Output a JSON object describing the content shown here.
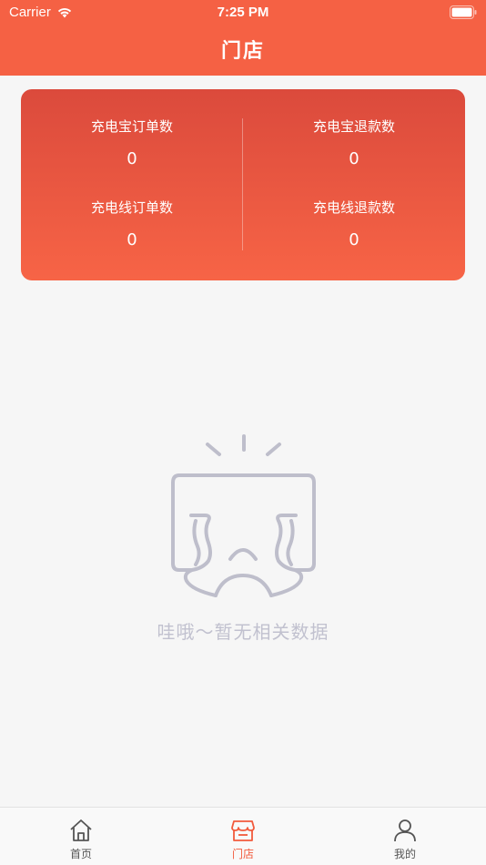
{
  "status_bar": {
    "carrier": "Carrier",
    "time": "7:25 PM"
  },
  "nav": {
    "title": "门店"
  },
  "stats": [
    {
      "label": "充电宝订单数",
      "value": "0"
    },
    {
      "label": "充电宝退款数",
      "value": "0"
    },
    {
      "label": "充电线订单数",
      "value": "0"
    },
    {
      "label": "充电线退款数",
      "value": "0"
    }
  ],
  "empty_state": {
    "message": "哇哦～暂无相关数据",
    "icon": "crying-box-icon"
  },
  "tabs": [
    {
      "label": "首页",
      "icon": "home-icon",
      "active": false
    },
    {
      "label": "门店",
      "icon": "store-icon",
      "active": true
    },
    {
      "label": "我的",
      "icon": "user-icon",
      "active": false
    }
  ],
  "colors": {
    "accent": "#f56144",
    "card_top": "#db4a3c",
    "card_bottom": "#f76446",
    "empty_gray": "#c1c1cf"
  }
}
